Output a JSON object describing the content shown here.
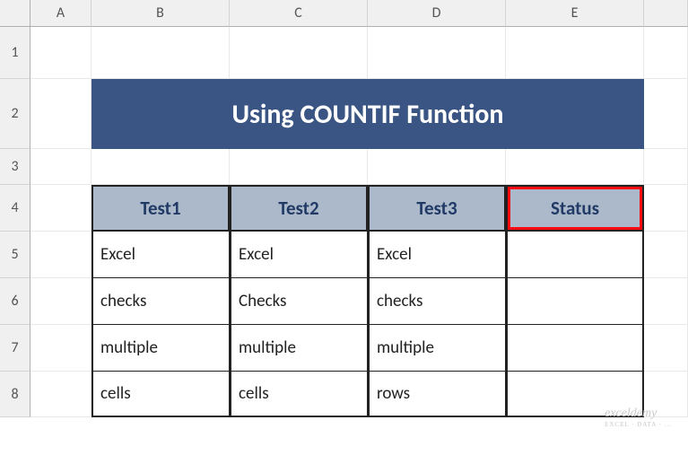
{
  "columns": [
    "A",
    "B",
    "C",
    "D",
    "E"
  ],
  "rows": [
    "1",
    "2",
    "3",
    "4",
    "5",
    "6",
    "7",
    "8"
  ],
  "title": "Using COUNTIF Function",
  "headers": [
    "Test1",
    "Test2",
    "Test3",
    "Status"
  ],
  "table": [
    [
      "Excel",
      "Excel",
      "Excel",
      ""
    ],
    [
      "checks",
      "Checks",
      "checks",
      ""
    ],
    [
      "multiple",
      "multiple",
      "multiple",
      ""
    ],
    [
      "cells",
      "cells",
      "rows",
      ""
    ]
  ],
  "watermark": "exceldemy",
  "watermark_sub": "EXCEL · DATA · ..."
}
